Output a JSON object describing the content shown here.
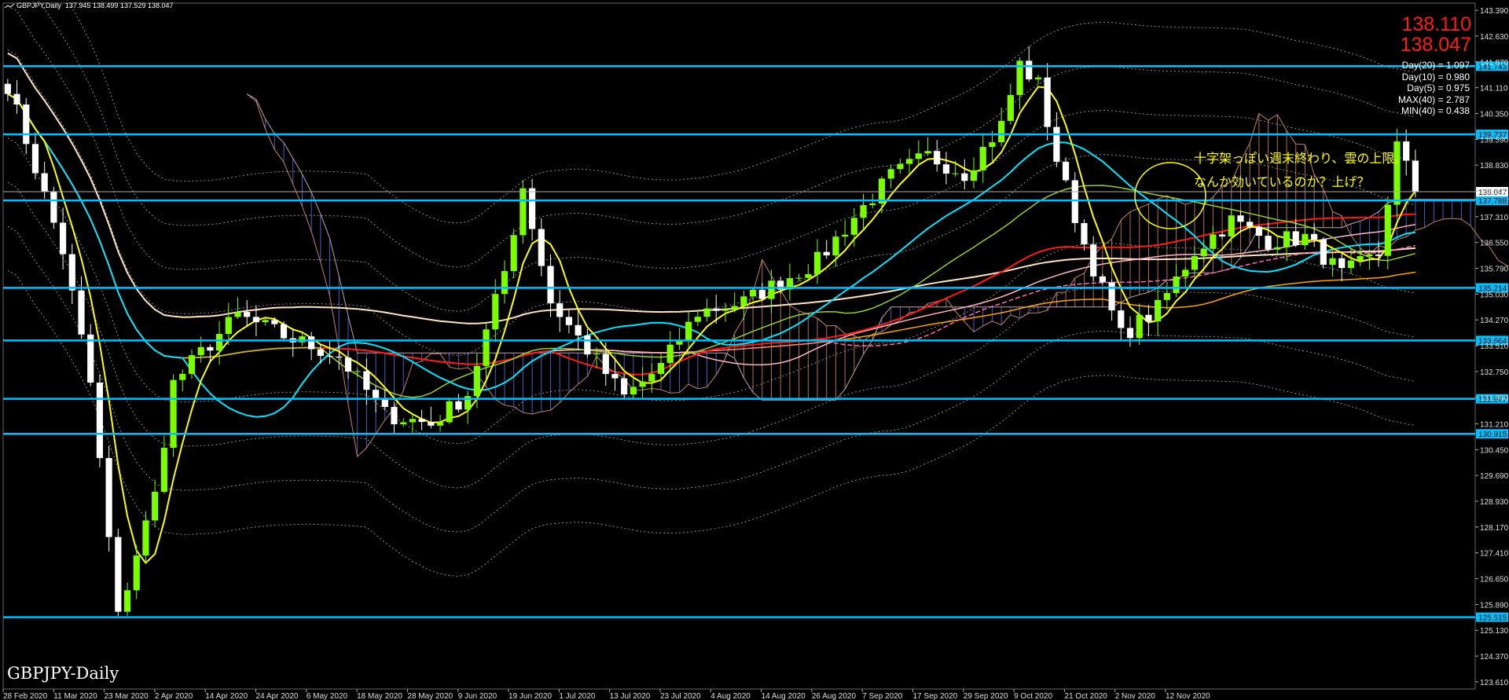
{
  "header": {
    "symbol": "GBPJPY,Daily",
    "ohlc": "137.945 138.499 137.529 138.047"
  },
  "prices": {
    "bid": "138.110",
    "ask": "138.047"
  },
  "stats": [
    "Day(20) = 1.097",
    "Day(10) = 0.980",
    "Day(5) = 0.975",
    "MAX(40) = 2.787",
    "MIN(40) = 0.438"
  ],
  "annotation": {
    "line1": "十字架っぽい週末終わり、雲の上限。",
    "line2": "なんか効いているのか？上げ？"
  },
  "watermark": "GBPJPY-Daily",
  "colors": {
    "bg": "#000000",
    "bull": "#7cfc00",
    "bear": "#ffffff",
    "level": "#00bfff",
    "ma_fast": "#ffff00",
    "ma_mid": "#00e5ff",
    "ma_red": "#ff1a1a",
    "cloud_up": "#e9967a",
    "cloud_dn": "#6a7bff",
    "annotation": "#ffff00",
    "price_text": "#ff1a1a"
  },
  "chart_data": {
    "type": "candlestick",
    "symbol": "GBPJPY",
    "timeframe": "Daily",
    "ylim": [
      123.4,
      143.6
    ],
    "y_ticks": [
      "143.390",
      "142.630",
      "141.870",
      "141.110",
      "140.350",
      "139.590",
      "138.830",
      "138.070",
      "137.310",
      "136.550",
      "135.790",
      "135.030",
      "134.270",
      "133.510",
      "132.750",
      "131.990",
      "131.210",
      "130.450",
      "129.690",
      "128.930",
      "128.170",
      "127.410",
      "126.650",
      "125.890",
      "125.130",
      "124.370",
      "123.610"
    ],
    "x_ticks": [
      "28 Feb 2020",
      "11 Mar 2020",
      "23 Mar 2020",
      "2 Apr 2020",
      "14 Apr 2020",
      "24 Apr 2020",
      "6 May 2020",
      "18 May 2020",
      "28 May 2020",
      "9 Jun 2020",
      "19 Jun 2020",
      "1 Jul 2020",
      "13 Jul 2020",
      "23 Jul 2020",
      "4 Aug 2020",
      "14 Aug 2020",
      "26 Aug 2020",
      "7 Sep 2020",
      "17 Sep 2020",
      "29 Sep 2020",
      "9 Oct 2020",
      "21 Oct 2020",
      "2 Nov 2020",
      "12 Nov 2020"
    ],
    "horizontal_levels": [
      "141.743",
      "139.737",
      "137.788",
      "135.214",
      "133.664",
      "131.947",
      "130.915",
      "125.515"
    ],
    "current_price": "138.047",
    "close_path": [
      [
        0,
        141.2
      ],
      [
        6,
        136.3
      ],
      [
        9,
        132.4
      ],
      [
        12,
        125.5
      ],
      [
        14,
        127.4
      ],
      [
        16,
        129.1
      ],
      [
        18,
        132.4
      ],
      [
        21,
        133.3
      ],
      [
        25,
        134.4
      ],
      [
        30,
        133.8
      ],
      [
        36,
        133.2
      ],
      [
        41,
        131.5
      ],
      [
        46,
        131.2
      ],
      [
        50,
        132.1
      ],
      [
        54,
        135.7
      ],
      [
        56,
        138.2
      ],
      [
        59,
        134.8
      ],
      [
        63,
        133.4
      ],
      [
        67,
        132.0
      ],
      [
        71,
        132.9
      ],
      [
        75,
        134.5
      ],
      [
        80,
        134.8
      ],
      [
        84,
        135.4
      ],
      [
        88,
        136.0
      ],
      [
        92,
        137.3
      ],
      [
        96,
        138.5
      ],
      [
        100,
        139.1
      ],
      [
        104,
        138.6
      ],
      [
        108,
        140.0
      ],
      [
        110,
        141.8
      ],
      [
        112,
        141.2
      ],
      [
        114,
        139.0
      ],
      [
        117,
        136.5
      ],
      [
        121,
        133.8
      ],
      [
        125,
        134.6
      ],
      [
        129,
        136.3
      ],
      [
        133,
        137.2
      ],
      [
        137,
        136.6
      ],
      [
        141,
        136.7
      ],
      [
        145,
        135.6
      ],
      [
        149,
        136.2
      ],
      [
        151,
        139.4
      ],
      [
        153,
        138.1
      ]
    ]
  }
}
